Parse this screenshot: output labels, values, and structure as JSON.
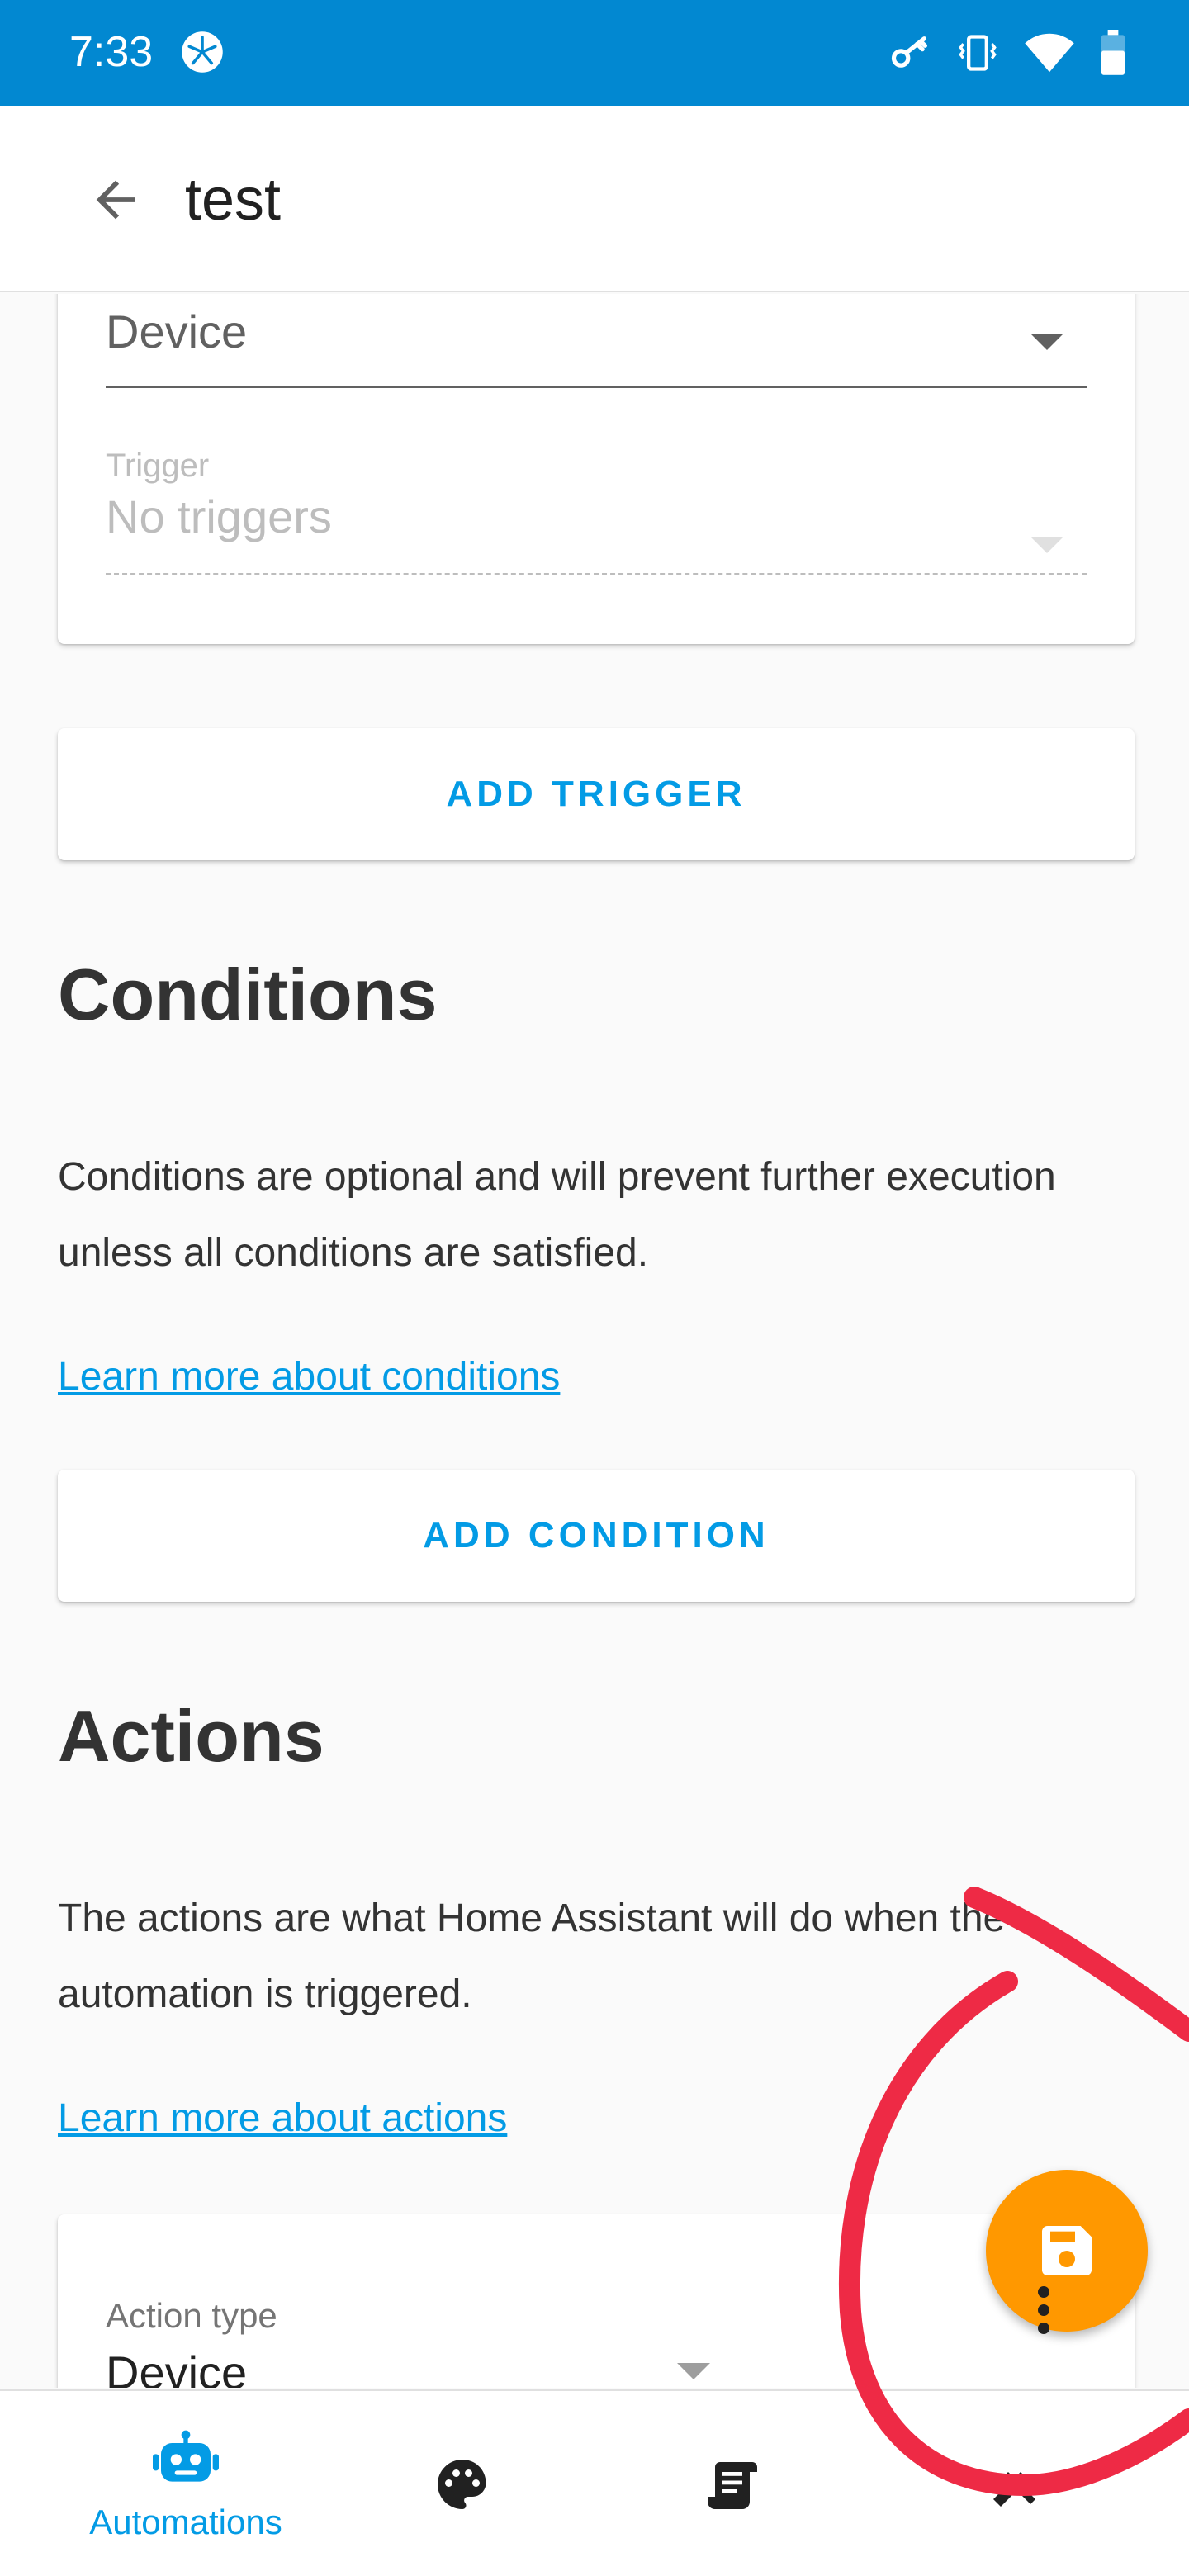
{
  "status_bar": {
    "time": "7:33"
  },
  "header": {
    "title": "test"
  },
  "trigger_card": {
    "device_select": {
      "value": "Device"
    },
    "trigger_select": {
      "label": "Trigger",
      "value": "No triggers"
    }
  },
  "add_trigger": {
    "label": "ADD TRIGGER"
  },
  "conditions": {
    "title": "Conditions",
    "description": "Conditions are optional and will prevent further execution unless all conditions are satisfied.",
    "link": "Learn more about conditions",
    "add_label": "ADD CONDITION"
  },
  "actions": {
    "title": "Actions",
    "description": "The actions are what Home Assistant will do when the automation is triggered.",
    "link": "Learn more about actions",
    "action_type_label": "Action type",
    "action_type_value": "Device"
  },
  "bottom_nav": {
    "items": [
      {
        "icon": "robot-icon",
        "label": "Automations",
        "active": true
      },
      {
        "icon": "palette-icon"
      },
      {
        "icon": "script-icon"
      },
      {
        "icon": "tools-icon"
      }
    ]
  },
  "fab": {
    "icon": "floppy-disk-icon"
  },
  "colors": {
    "status_bar": "#0288d1",
    "accent": "#039be5",
    "fab": "#ff9800",
    "annotation": "#ee2a45"
  }
}
